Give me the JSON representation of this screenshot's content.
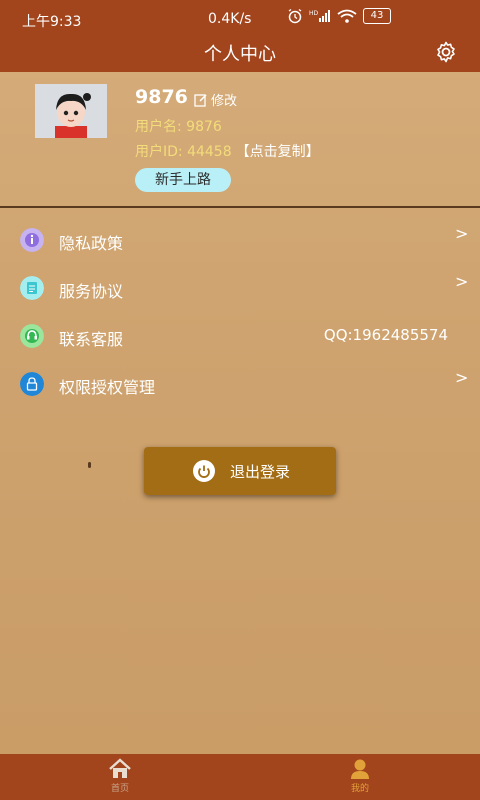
{
  "status_bar": {
    "time": "上午9:33",
    "network_speed": "0.4K/s",
    "battery": "43"
  },
  "header": {
    "title": "个人中心",
    "settings_icon": "gear-icon"
  },
  "profile": {
    "display_name": "9876",
    "edit_label": "修改",
    "username_text": "用户名: 9876",
    "user_id_text": "用户ID: 44458",
    "copy_label": "【点击复制】",
    "newbie_button": "新手上路"
  },
  "menu": {
    "items": [
      {
        "label": "隐私政策",
        "icon": "privacy-icon",
        "has_chevron": true
      },
      {
        "label": "服务协议",
        "icon": "document-icon",
        "has_chevron": true
      },
      {
        "label": "联系客服",
        "icon": "headset-icon",
        "value": "QQ:1962485574"
      },
      {
        "label": "权限授权管理",
        "icon": "lock-icon",
        "has_chevron": true
      }
    ]
  },
  "logout": {
    "label": "退出登录"
  },
  "bottom_nav": {
    "tabs": [
      {
        "label": "首页",
        "icon": "home-icon",
        "active": false
      },
      {
        "label": "我的",
        "icon": "person-icon",
        "active": true
      }
    ]
  },
  "colors": {
    "header_bg": "#a2441c",
    "accent_yellow": "#f3dc7a",
    "logout_bg": "#a36d16",
    "newbie_bg": "#b9f0f7"
  }
}
